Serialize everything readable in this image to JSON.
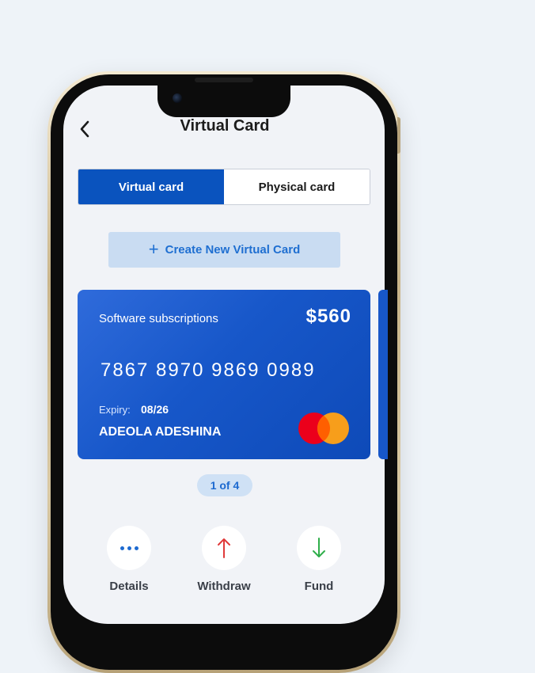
{
  "header": {
    "title": "Virtual Card",
    "back_icon": "chevron-left-icon"
  },
  "tabs": [
    {
      "label": "Virtual card",
      "active": true
    },
    {
      "label": "Physical card",
      "active": false
    }
  ],
  "create_button": {
    "label": "Create New Virtual Card",
    "icon": "plus-icon"
  },
  "card": {
    "label": "Software subscriptions",
    "amount": "$560",
    "number": "7867 8970 9869 0989",
    "expiry_label": "Expiry:",
    "expiry": "08/26",
    "holder": "ADEOLA ADESHINA",
    "brand_icon": "mastercard-icon"
  },
  "pager": {
    "text": "1 of 4"
  },
  "actions": [
    {
      "label": "Details",
      "icon": "more-dots-icon"
    },
    {
      "label": "Withdraw",
      "icon": "arrow-up-icon"
    },
    {
      "label": "Fund",
      "icon": "arrow-down-icon"
    }
  ],
  "colors": {
    "primary": "#0a53be",
    "withdraw": "#e03a3a",
    "fund": "#2fae4a"
  }
}
